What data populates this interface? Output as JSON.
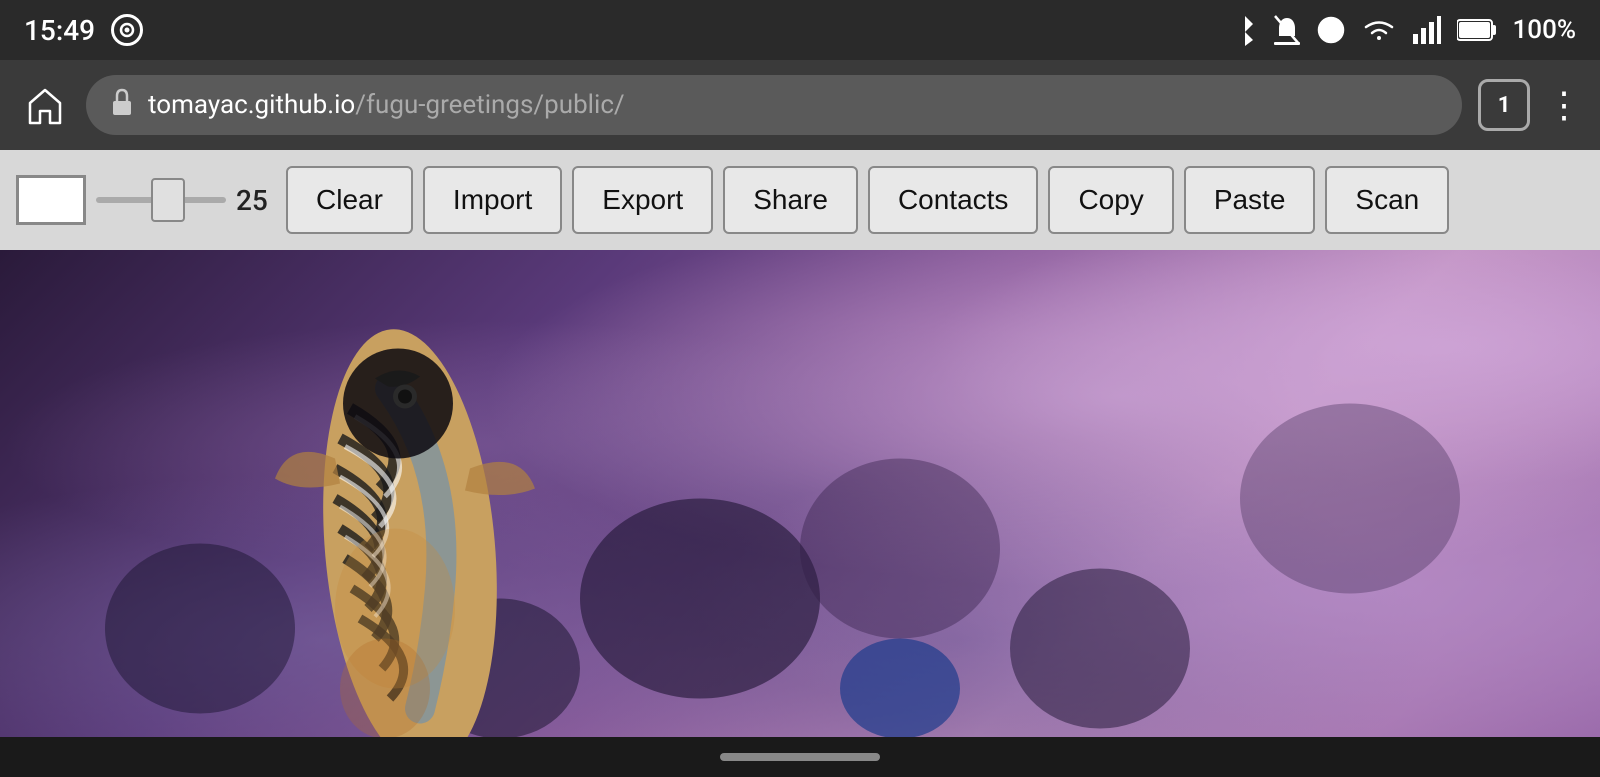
{
  "statusBar": {
    "time": "15:49",
    "battery": "100%",
    "tabCount": "1"
  },
  "browserBar": {
    "urlProtocol": "tomayac.github.io",
    "urlPath": "/fugu-greetings/public/",
    "tabCount": "1"
  },
  "toolbar": {
    "sliderValue": "25",
    "buttons": [
      {
        "id": "clear",
        "label": "Clear"
      },
      {
        "id": "import",
        "label": "Import"
      },
      {
        "id": "export",
        "label": "Export"
      },
      {
        "id": "share",
        "label": "Share"
      },
      {
        "id": "contacts",
        "label": "Contacts"
      },
      {
        "id": "copy",
        "label": "Copy"
      },
      {
        "id": "paste",
        "label": "Paste"
      },
      {
        "id": "scan",
        "label": "Scan"
      }
    ]
  },
  "navBar": {
    "pillLabel": "home-indicator"
  }
}
